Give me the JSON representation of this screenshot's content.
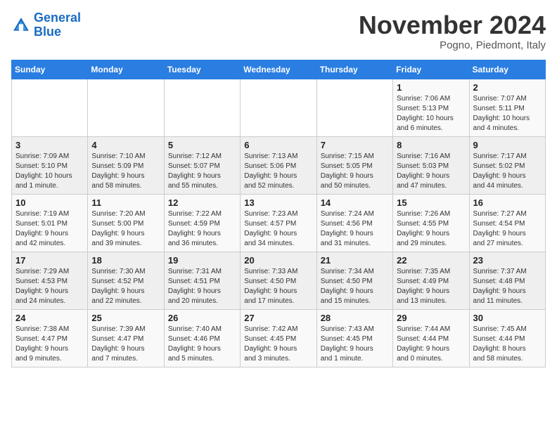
{
  "logo": {
    "line1": "General",
    "line2": "Blue"
  },
  "title": "November 2024",
  "subtitle": "Pogno, Piedmont, Italy",
  "days_of_week": [
    "Sunday",
    "Monday",
    "Tuesday",
    "Wednesday",
    "Thursday",
    "Friday",
    "Saturday"
  ],
  "weeks": [
    [
      {
        "day": "",
        "info": ""
      },
      {
        "day": "",
        "info": ""
      },
      {
        "day": "",
        "info": ""
      },
      {
        "day": "",
        "info": ""
      },
      {
        "day": "",
        "info": ""
      },
      {
        "day": "1",
        "info": "Sunrise: 7:06 AM\nSunset: 5:13 PM\nDaylight: 10 hours\nand 6 minutes."
      },
      {
        "day": "2",
        "info": "Sunrise: 7:07 AM\nSunset: 5:11 PM\nDaylight: 10 hours\nand 4 minutes."
      }
    ],
    [
      {
        "day": "3",
        "info": "Sunrise: 7:09 AM\nSunset: 5:10 PM\nDaylight: 10 hours\nand 1 minute."
      },
      {
        "day": "4",
        "info": "Sunrise: 7:10 AM\nSunset: 5:09 PM\nDaylight: 9 hours\nand 58 minutes."
      },
      {
        "day": "5",
        "info": "Sunrise: 7:12 AM\nSunset: 5:07 PM\nDaylight: 9 hours\nand 55 minutes."
      },
      {
        "day": "6",
        "info": "Sunrise: 7:13 AM\nSunset: 5:06 PM\nDaylight: 9 hours\nand 52 minutes."
      },
      {
        "day": "7",
        "info": "Sunrise: 7:15 AM\nSunset: 5:05 PM\nDaylight: 9 hours\nand 50 minutes."
      },
      {
        "day": "8",
        "info": "Sunrise: 7:16 AM\nSunset: 5:03 PM\nDaylight: 9 hours\nand 47 minutes."
      },
      {
        "day": "9",
        "info": "Sunrise: 7:17 AM\nSunset: 5:02 PM\nDaylight: 9 hours\nand 44 minutes."
      }
    ],
    [
      {
        "day": "10",
        "info": "Sunrise: 7:19 AM\nSunset: 5:01 PM\nDaylight: 9 hours\nand 42 minutes."
      },
      {
        "day": "11",
        "info": "Sunrise: 7:20 AM\nSunset: 5:00 PM\nDaylight: 9 hours\nand 39 minutes."
      },
      {
        "day": "12",
        "info": "Sunrise: 7:22 AM\nSunset: 4:59 PM\nDaylight: 9 hours\nand 36 minutes."
      },
      {
        "day": "13",
        "info": "Sunrise: 7:23 AM\nSunset: 4:57 PM\nDaylight: 9 hours\nand 34 minutes."
      },
      {
        "day": "14",
        "info": "Sunrise: 7:24 AM\nSunset: 4:56 PM\nDaylight: 9 hours\nand 31 minutes."
      },
      {
        "day": "15",
        "info": "Sunrise: 7:26 AM\nSunset: 4:55 PM\nDaylight: 9 hours\nand 29 minutes."
      },
      {
        "day": "16",
        "info": "Sunrise: 7:27 AM\nSunset: 4:54 PM\nDaylight: 9 hours\nand 27 minutes."
      }
    ],
    [
      {
        "day": "17",
        "info": "Sunrise: 7:29 AM\nSunset: 4:53 PM\nDaylight: 9 hours\nand 24 minutes."
      },
      {
        "day": "18",
        "info": "Sunrise: 7:30 AM\nSunset: 4:52 PM\nDaylight: 9 hours\nand 22 minutes."
      },
      {
        "day": "19",
        "info": "Sunrise: 7:31 AM\nSunset: 4:51 PM\nDaylight: 9 hours\nand 20 minutes."
      },
      {
        "day": "20",
        "info": "Sunrise: 7:33 AM\nSunset: 4:50 PM\nDaylight: 9 hours\nand 17 minutes."
      },
      {
        "day": "21",
        "info": "Sunrise: 7:34 AM\nSunset: 4:50 PM\nDaylight: 9 hours\nand 15 minutes."
      },
      {
        "day": "22",
        "info": "Sunrise: 7:35 AM\nSunset: 4:49 PM\nDaylight: 9 hours\nand 13 minutes."
      },
      {
        "day": "23",
        "info": "Sunrise: 7:37 AM\nSunset: 4:48 PM\nDaylight: 9 hours\nand 11 minutes."
      }
    ],
    [
      {
        "day": "24",
        "info": "Sunrise: 7:38 AM\nSunset: 4:47 PM\nDaylight: 9 hours\nand 9 minutes."
      },
      {
        "day": "25",
        "info": "Sunrise: 7:39 AM\nSunset: 4:47 PM\nDaylight: 9 hours\nand 7 minutes."
      },
      {
        "day": "26",
        "info": "Sunrise: 7:40 AM\nSunset: 4:46 PM\nDaylight: 9 hours\nand 5 minutes."
      },
      {
        "day": "27",
        "info": "Sunrise: 7:42 AM\nSunset: 4:45 PM\nDaylight: 9 hours\nand 3 minutes."
      },
      {
        "day": "28",
        "info": "Sunrise: 7:43 AM\nSunset: 4:45 PM\nDaylight: 9 hours\nand 1 minute."
      },
      {
        "day": "29",
        "info": "Sunrise: 7:44 AM\nSunset: 4:44 PM\nDaylight: 9 hours\nand 0 minutes."
      },
      {
        "day": "30",
        "info": "Sunrise: 7:45 AM\nSunset: 4:44 PM\nDaylight: 8 hours\nand 58 minutes."
      }
    ]
  ]
}
